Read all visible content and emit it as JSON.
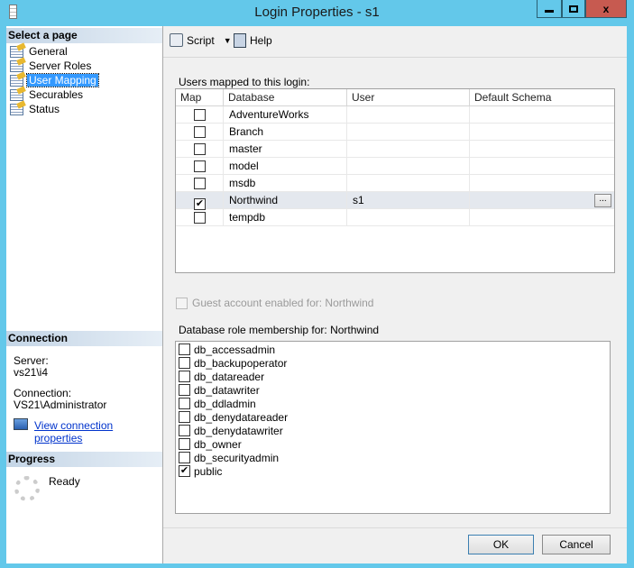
{
  "window": {
    "title": "Login Properties - s1",
    "minimize": "—",
    "maximize": "□",
    "close": "x"
  },
  "left": {
    "select_header": "Select a page",
    "pages": [
      {
        "label": "General"
      },
      {
        "label": "Server Roles"
      },
      {
        "label": "User Mapping",
        "selected": true
      },
      {
        "label": "Securables"
      },
      {
        "label": "Status"
      }
    ],
    "connection_header": "Connection",
    "server_label": "Server:",
    "server_value": "vs21\\i4",
    "connection_label": "Connection:",
    "connection_value": "VS21\\Administrator",
    "view_link": "View connection properties",
    "progress_header": "Progress",
    "progress_status": "Ready"
  },
  "toolbar": {
    "script": "Script",
    "help": "Help"
  },
  "users": {
    "label": "Users mapped to this login:",
    "columns": [
      "Map",
      "Database",
      "User",
      "Default Schema"
    ],
    "rows": [
      {
        "map": false,
        "database": "AdventureWorks",
        "user": "",
        "schema": ""
      },
      {
        "map": false,
        "database": "Branch",
        "user": "",
        "schema": ""
      },
      {
        "map": false,
        "database": "master",
        "user": "",
        "schema": ""
      },
      {
        "map": false,
        "database": "model",
        "user": "",
        "schema": ""
      },
      {
        "map": false,
        "database": "msdb",
        "user": "",
        "schema": ""
      },
      {
        "map": true,
        "database": "Northwind",
        "user": "s1",
        "schema": "",
        "selected": true
      },
      {
        "map": false,
        "database": "tempdb",
        "user": "",
        "schema": ""
      }
    ],
    "ellipsis": "..."
  },
  "guest": {
    "label": "Guest account enabled for: Northwind",
    "checked": false
  },
  "roles": {
    "label": "Database role membership for: Northwind",
    "items": [
      {
        "name": "db_accessadmin",
        "checked": false
      },
      {
        "name": "db_backupoperator",
        "checked": false
      },
      {
        "name": "db_datareader",
        "checked": false
      },
      {
        "name": "db_datawriter",
        "checked": false
      },
      {
        "name": "db_ddladmin",
        "checked": false
      },
      {
        "name": "db_denydatareader",
        "checked": false
      },
      {
        "name": "db_denydatawriter",
        "checked": false
      },
      {
        "name": "db_owner",
        "checked": false
      },
      {
        "name": "db_securityadmin",
        "checked": false
      },
      {
        "name": "public",
        "checked": true
      }
    ]
  },
  "buttons": {
    "ok": "OK",
    "cancel": "Cancel"
  }
}
